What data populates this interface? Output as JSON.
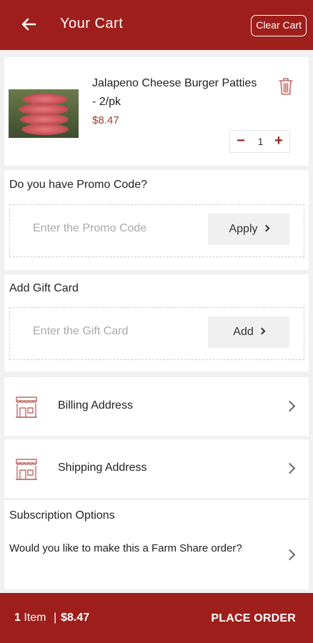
{
  "header": {
    "title": "Your Cart",
    "clear_label": "Clear Cart"
  },
  "cart_item": {
    "name": "Jalapeno Cheese Burger Patties - 2/pk",
    "price": "$8.47",
    "quantity": "1",
    "minus": "−",
    "plus": "+"
  },
  "promo": {
    "title": "Do you have Promo Code?",
    "placeholder": "Enter the Promo Code",
    "button": "Apply"
  },
  "gift": {
    "title": "Add Gift Card",
    "placeholder": "Enter the Gift Card",
    "button": "Add"
  },
  "addresses": {
    "billing": "Billing Address",
    "shipping": "Shipping Address"
  },
  "subscription": {
    "title": "Subscription Options",
    "question": "Would you like to make this a Farm Share order?"
  },
  "footer": {
    "count": "1",
    "items_word": "Item",
    "separator": "|",
    "total": "$8.47",
    "place_order": "PLACE ORDER"
  },
  "colors": {
    "brand": "#9e1e1b",
    "price": "#a53a34"
  },
  "icons": [
    "back-arrow-icon",
    "trash-icon",
    "storefront-icon",
    "chevron-right-icon"
  ]
}
